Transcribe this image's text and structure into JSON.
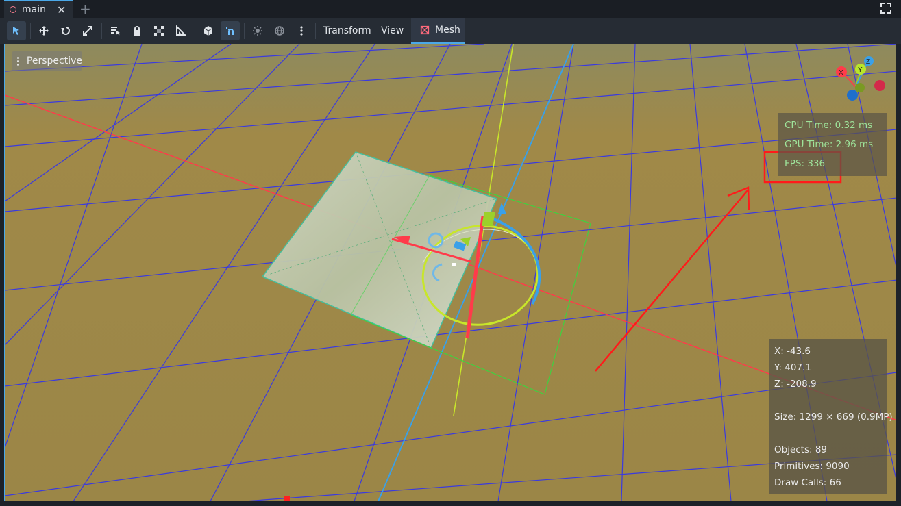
{
  "tabs": [
    {
      "label": "main",
      "icon": "scene-ring-icon"
    }
  ],
  "toolbar": {
    "tools": [
      "select-icon",
      "move-icon",
      "rotate-icon",
      "scale-icon",
      "list-select-icon",
      "lock-icon",
      "group-icon",
      "ruler-icon",
      "local-space-icon",
      "snap-icon",
      "sun-icon",
      "environment-icon",
      "more-icon"
    ],
    "menus": {
      "transform": "Transform",
      "view": "View",
      "mesh": "Mesh"
    }
  },
  "viewport": {
    "mode_label": "Perspective",
    "gizmo": {
      "x": "X",
      "y": "Y",
      "z": "Z"
    },
    "stats": {
      "cpu": "CPU Time: 0.32 ms",
      "gpu": "GPU Time: 2.96 ms",
      "fps": "FPS: 336"
    },
    "info": {
      "x": "X: -43.6",
      "y": "Y: 407.1",
      "z": "Z: -208.9",
      "size": "Size: 1299 × 669 (0.9MP)",
      "objects": "Objects: 89",
      "primitives": "Primitives: 9090",
      "draw_calls": "Draw Calls: 66"
    }
  },
  "colors": {
    "accent": "#4aa8e8",
    "ground": "#9b8647",
    "grid": "#3a3adf",
    "x_axis": "#ff3b4a",
    "y_axis": "#b8e62a",
    "z_axis": "#3aa0e8",
    "annotation": "#ff1a1a"
  }
}
